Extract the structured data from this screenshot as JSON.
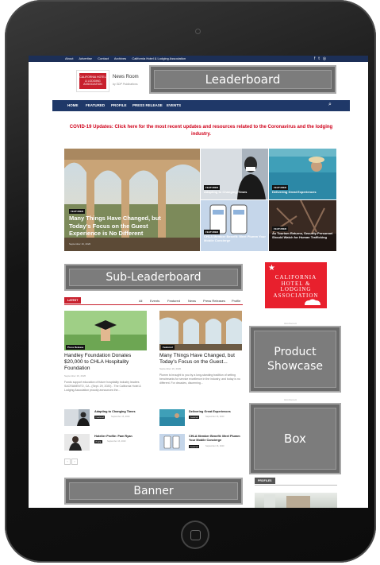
{
  "topbar": {
    "links": [
      "About",
      "Advertise",
      "Contact",
      "Archives",
      "California Hotel & Lodging Association"
    ],
    "social_icons": [
      "facebook-icon",
      "twitter-icon",
      "instagram-icon"
    ]
  },
  "header": {
    "logo_text": "CALIFORNIA HOTEL & LODGING ASSOCIATION",
    "site_title": "News Room",
    "byline": "by SDP Publications",
    "leaderboard_label": "Leaderboard"
  },
  "nav": {
    "items": [
      "HOME",
      "FEATURED",
      "PROFILE",
      "PRESS RELEASE",
      "EVENTS"
    ],
    "search_icon": "search-icon"
  },
  "alert": {
    "text": "COVID-19 Updates: Click here for the most recent updates and resources related to the Coronavirus and the lodging industry."
  },
  "hero": {
    "main": {
      "tag": "FEATURED",
      "title": "Many Things Have Changed, but Today's Focus on the Guest Experience is No Different",
      "date": "September 16, 2020"
    },
    "tiles": [
      {
        "tag": "FEATURED",
        "title": "Adapting to Changing Times"
      },
      {
        "tag": "FEATURED",
        "title": "Delivering Great Experiences"
      },
      {
        "tag": "FEATURED",
        "title": "CHLA Member Benefit: Meet Plumm Your Mobile Concierge"
      },
      {
        "tag": "FEATURED",
        "title": "As Tourism Returns, Security Personnel Should Watch for Human Trafficking"
      }
    ]
  },
  "ads": {
    "sub_leaderboard": "Sub-Leaderboard",
    "product_showcase": "Product Showcase",
    "box": "Box",
    "banner": "Banner",
    "advertisement_label": "Advertisement"
  },
  "sidebar": {
    "logo_lines": [
      "CALIFORNIA",
      "HOTEL & LODGING",
      "ASSOCIATION"
    ],
    "profiles_label": "PROFILES"
  },
  "latest": {
    "tab_label": "LATEST",
    "filters": [
      "All",
      "Events",
      "Featured",
      "News",
      "Press Releases",
      "Profile"
    ],
    "cards": [
      {
        "tag": "Press Release",
        "title": "Handley Foundation Donates $20,000 to CHLA Hospitality Foundation",
        "date": "September 16, 2020",
        "excerpt": "Funds support education of future hospitality industry leaders SACRAMENTO, CA - (Sept. 29, 2020) - The California Hotel & Lodging Association proudly announces the..."
      },
      {
        "tag": "Featured",
        "title": "Many Things Have Changed, but Today's Focus on the Guest...",
        "date": "September 16, 2020",
        "excerpt": "Plumm is brought to you by a long-standing tradition of setting benchmarks for service excellence in the industry, and today is no different. For decades, discerning..."
      }
    ],
    "small": [
      {
        "title": "Adapting to Changing Times",
        "badge": "Featured",
        "date": "September 16, 2020"
      },
      {
        "title": "Delivering Great Experiences",
        "badge": "Featured",
        "date": "September 16, 2020"
      },
      {
        "title": "Hotelier Profile: Pam Ryan",
        "badge": "Profile",
        "date": "September 16, 2020"
      },
      {
        "title": "CHLA Member Benefit: Meet Plumm Your Mobile Concierge",
        "badge": "Featured",
        "date": "September 16, 2020"
      }
    ],
    "pager": [
      "‹",
      "›"
    ]
  }
}
